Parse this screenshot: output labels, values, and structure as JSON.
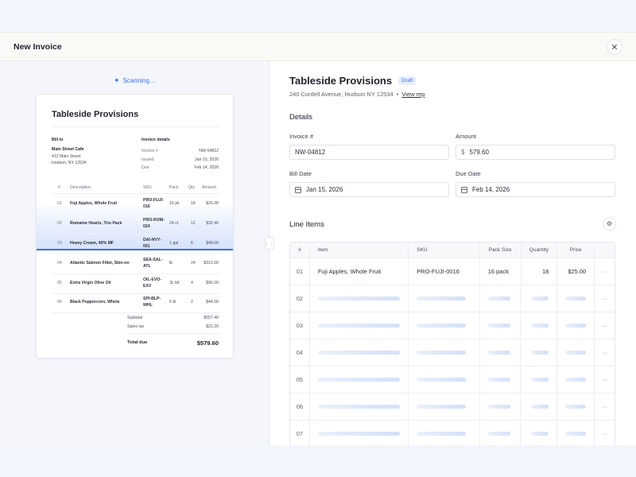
{
  "modal": {
    "title": "New Invoice",
    "close_icon": "close-icon"
  },
  "scan": {
    "status": "Scanning…",
    "icon": "sparkle-icon"
  },
  "document": {
    "title": "Tableside Provisions",
    "bill_to_label": "Bill to",
    "bill_to_name": "Main Street Cafe",
    "bill_to_street": "412 Main Street",
    "bill_to_city": "Hudson, NY 12534",
    "details_label": "Invoice details",
    "invoice_label": "Invoice #",
    "invoice_value": "NW-04812",
    "issued_label": "Issued",
    "issued_value": "Jan 15, 2026",
    "due_label": "Due",
    "due_value": "Feb 14, 2026",
    "columns": [
      "#",
      "Description",
      "SKU",
      "Pack",
      "Qty",
      "Amount"
    ],
    "rows": [
      {
        "n": "01",
        "desc": "Fuji Apples, Whole Fruit",
        "sku1": "PRO-FUJI-",
        "sku2": "016",
        "pack": "16 pk",
        "qty": "18",
        "amount": "$25.00"
      },
      {
        "n": "02",
        "desc": "Romaine Hearts, Trio Pack",
        "sku1": "PRO-ROM-",
        "sku2": "024",
        "pack": "24 ct",
        "qty": "12",
        "amount": "$32.40"
      },
      {
        "n": "03",
        "desc": "Heavy Cream, 40% MF",
        "sku1": "DAI-HVY-",
        "sku2": "001",
        "pack": "1 gal",
        "qty": "6",
        "amount": "$48.00"
      },
      {
        "n": "04",
        "desc": "Atlantic Salmon Fillet, Skin-on",
        "sku1": "SEA-SAL-",
        "sku2": "ATL",
        "pack": "lb",
        "qty": "24",
        "amount": "$312.00"
      },
      {
        "n": "05",
        "desc": "Extra Virgin Olive Oil",
        "sku1": "OIL-EVO-",
        "sku2": "EXV",
        "pack": "3L btl",
        "qty": "4",
        "amount": "$96.00"
      },
      {
        "n": "06",
        "desc": "Black Peppercorn, Whole",
        "sku1": "SPI-BLP-",
        "sku2": "WHL",
        "pack": "5 lb",
        "qty": "2",
        "amount": "$44.00"
      }
    ],
    "subtotal_label": "Subtotal",
    "subtotal_value": "$557.40",
    "tax_label": "Sales tax",
    "tax_value": "$22.20",
    "total_label": "Total due",
    "total_value": "$579.60"
  },
  "form": {
    "company": "Tableside Provisions",
    "badge": "Draft",
    "address": "240 Cordell Avenue, Hudson NY 12534",
    "separator": "•",
    "view_rep": "View rep",
    "details_title": "Details",
    "invoice_label": "Invoice #",
    "invoice_value": "NW-04812",
    "amount_label": "Amount",
    "amount_prefix": "$",
    "amount_value": "579.60",
    "bill_date_label": "Bill Date",
    "bill_date_value": "Jan 15, 2026",
    "due_date_label": "Due Date",
    "due_date_value": "Feb 14, 2026"
  },
  "line_items": {
    "title": "Line Items",
    "settings_icon": "sliders-icon",
    "columns": [
      "#",
      "Item",
      "SKU",
      "Pack Size",
      "Quantity",
      "Price"
    ],
    "first_row": {
      "n": "01",
      "item": "Fuji Apples, Whole Fruit",
      "sku": "PRO-FUJI-0016",
      "pack": "16 pack",
      "qty": "18",
      "price": "$25.00",
      "more": "···"
    },
    "loading_rows": [
      "02",
      "03",
      "04",
      "05",
      "06",
      "07"
    ],
    "more": "···"
  }
}
